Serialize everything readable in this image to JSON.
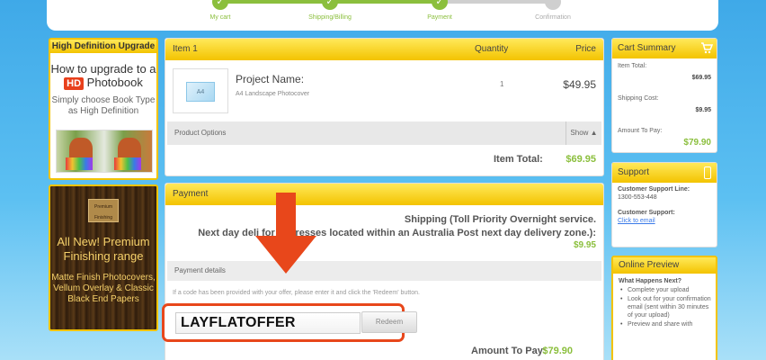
{
  "progress": {
    "steps": [
      {
        "label": "My cart",
        "done": true
      },
      {
        "label": "Shipping/Billing",
        "done": true
      },
      {
        "label": "Payment",
        "done": true
      },
      {
        "label": "Confirmation",
        "done": false
      }
    ],
    "check_glyph": "✓"
  },
  "left": {
    "hd_title": "High Definition Upgrade",
    "hd_line1": "How to upgrade to a",
    "hd_badge": "HD",
    "hd_word": "Photobook",
    "hd_simple1": "Simply choose  Book Type",
    "hd_simple2": "as  High Definition",
    "premium_book_text": "Premium Finishing",
    "premium_title": "All New! Premium Finishing range",
    "premium_desc": "Matte Finish Photocovers, Vellum Overlay & Classic Black End Papers"
  },
  "item": {
    "head_label": "Item 1",
    "qty_label": "Quantity",
    "price_label": "Price",
    "thumb_label": "A4",
    "project_name": "Project Name:",
    "project_sub": "A4 Landscape Photocover",
    "quantity": "1",
    "price": "$49.95",
    "options_label": "Product Options",
    "options_show": "Show ▲",
    "total_label": "Item Total:",
    "total_value": "$69.95"
  },
  "payment": {
    "head_label": "Payment",
    "shipping_line1": "Shipping (Toll Priority Overnight service.",
    "shipping_line2": "Next day deli          for addresses located within an Australia Post next day delivery zone.):",
    "shipping_price": "$9.95",
    "details_label": "Payment details",
    "promo_hint": "If a code has been provided with your offer, please enter it and click the 'Redeem' button.",
    "promo_value": "LAYFLATOFFER",
    "redeem_label": "Redeem",
    "amount_label": "Amount To Pay:",
    "amount_value": "$79.90"
  },
  "summary": {
    "title": "Cart Summary",
    "item_total_label": "Item Total:",
    "item_total_value": "$69.95",
    "shipping_label": "Shipping Cost:",
    "shipping_value": "$9.95",
    "amount_label": "Amount To Pay:",
    "amount_value": "$79.90"
  },
  "support": {
    "title": "Support",
    "line_label": "Customer Support Line:",
    "line_value": "1300-553-448",
    "cs_label": "Customer Support:",
    "email_link": "Click to email"
  },
  "preview": {
    "title": "Online Preview",
    "question": "What Happens Next?",
    "items": [
      "Complete your upload",
      "Look out for your confirmation email (sent within 30 minutes of your upload)",
      "Preview and share with"
    ]
  },
  "colors": {
    "accent_yellow": "#f3c300",
    "success_green": "#8bbf3d",
    "highlight_orange": "#e8471b"
  }
}
